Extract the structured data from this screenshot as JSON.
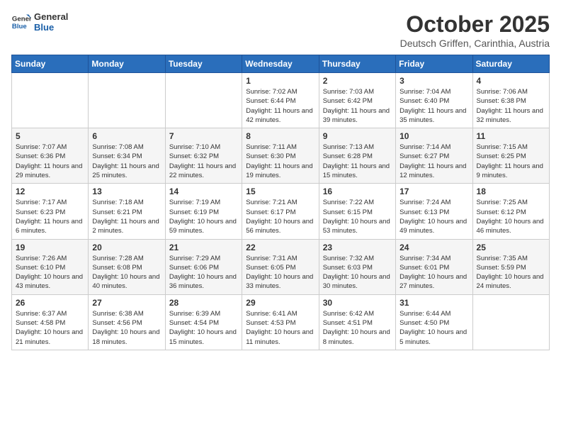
{
  "header": {
    "logo_line1": "General",
    "logo_line2": "Blue",
    "month": "October 2025",
    "location": "Deutsch Griffen, Carinthia, Austria"
  },
  "weekdays": [
    "Sunday",
    "Monday",
    "Tuesday",
    "Wednesday",
    "Thursday",
    "Friday",
    "Saturday"
  ],
  "weeks": [
    [
      {
        "day": "",
        "info": ""
      },
      {
        "day": "",
        "info": ""
      },
      {
        "day": "",
        "info": ""
      },
      {
        "day": "1",
        "info": "Sunrise: 7:02 AM\nSunset: 6:44 PM\nDaylight: 11 hours and 42 minutes."
      },
      {
        "day": "2",
        "info": "Sunrise: 7:03 AM\nSunset: 6:42 PM\nDaylight: 11 hours and 39 minutes."
      },
      {
        "day": "3",
        "info": "Sunrise: 7:04 AM\nSunset: 6:40 PM\nDaylight: 11 hours and 35 minutes."
      },
      {
        "day": "4",
        "info": "Sunrise: 7:06 AM\nSunset: 6:38 PM\nDaylight: 11 hours and 32 minutes."
      }
    ],
    [
      {
        "day": "5",
        "info": "Sunrise: 7:07 AM\nSunset: 6:36 PM\nDaylight: 11 hours and 29 minutes."
      },
      {
        "day": "6",
        "info": "Sunrise: 7:08 AM\nSunset: 6:34 PM\nDaylight: 11 hours and 25 minutes."
      },
      {
        "day": "7",
        "info": "Sunrise: 7:10 AM\nSunset: 6:32 PM\nDaylight: 11 hours and 22 minutes."
      },
      {
        "day": "8",
        "info": "Sunrise: 7:11 AM\nSunset: 6:30 PM\nDaylight: 11 hours and 19 minutes."
      },
      {
        "day": "9",
        "info": "Sunrise: 7:13 AM\nSunset: 6:28 PM\nDaylight: 11 hours and 15 minutes."
      },
      {
        "day": "10",
        "info": "Sunrise: 7:14 AM\nSunset: 6:27 PM\nDaylight: 11 hours and 12 minutes."
      },
      {
        "day": "11",
        "info": "Sunrise: 7:15 AM\nSunset: 6:25 PM\nDaylight: 11 hours and 9 minutes."
      }
    ],
    [
      {
        "day": "12",
        "info": "Sunrise: 7:17 AM\nSunset: 6:23 PM\nDaylight: 11 hours and 6 minutes."
      },
      {
        "day": "13",
        "info": "Sunrise: 7:18 AM\nSunset: 6:21 PM\nDaylight: 11 hours and 2 minutes."
      },
      {
        "day": "14",
        "info": "Sunrise: 7:19 AM\nSunset: 6:19 PM\nDaylight: 10 hours and 59 minutes."
      },
      {
        "day": "15",
        "info": "Sunrise: 7:21 AM\nSunset: 6:17 PM\nDaylight: 10 hours and 56 minutes."
      },
      {
        "day": "16",
        "info": "Sunrise: 7:22 AM\nSunset: 6:15 PM\nDaylight: 10 hours and 53 minutes."
      },
      {
        "day": "17",
        "info": "Sunrise: 7:24 AM\nSunset: 6:13 PM\nDaylight: 10 hours and 49 minutes."
      },
      {
        "day": "18",
        "info": "Sunrise: 7:25 AM\nSunset: 6:12 PM\nDaylight: 10 hours and 46 minutes."
      }
    ],
    [
      {
        "day": "19",
        "info": "Sunrise: 7:26 AM\nSunset: 6:10 PM\nDaylight: 10 hours and 43 minutes."
      },
      {
        "day": "20",
        "info": "Sunrise: 7:28 AM\nSunset: 6:08 PM\nDaylight: 10 hours and 40 minutes."
      },
      {
        "day": "21",
        "info": "Sunrise: 7:29 AM\nSunset: 6:06 PM\nDaylight: 10 hours and 36 minutes."
      },
      {
        "day": "22",
        "info": "Sunrise: 7:31 AM\nSunset: 6:05 PM\nDaylight: 10 hours and 33 minutes."
      },
      {
        "day": "23",
        "info": "Sunrise: 7:32 AM\nSunset: 6:03 PM\nDaylight: 10 hours and 30 minutes."
      },
      {
        "day": "24",
        "info": "Sunrise: 7:34 AM\nSunset: 6:01 PM\nDaylight: 10 hours and 27 minutes."
      },
      {
        "day": "25",
        "info": "Sunrise: 7:35 AM\nSunset: 5:59 PM\nDaylight: 10 hours and 24 minutes."
      }
    ],
    [
      {
        "day": "26",
        "info": "Sunrise: 6:37 AM\nSunset: 4:58 PM\nDaylight: 10 hours and 21 minutes."
      },
      {
        "day": "27",
        "info": "Sunrise: 6:38 AM\nSunset: 4:56 PM\nDaylight: 10 hours and 18 minutes."
      },
      {
        "day": "28",
        "info": "Sunrise: 6:39 AM\nSunset: 4:54 PM\nDaylight: 10 hours and 15 minutes."
      },
      {
        "day": "29",
        "info": "Sunrise: 6:41 AM\nSunset: 4:53 PM\nDaylight: 10 hours and 11 minutes."
      },
      {
        "day": "30",
        "info": "Sunrise: 6:42 AM\nSunset: 4:51 PM\nDaylight: 10 hours and 8 minutes."
      },
      {
        "day": "31",
        "info": "Sunrise: 6:44 AM\nSunset: 4:50 PM\nDaylight: 10 hours and 5 minutes."
      },
      {
        "day": "",
        "info": ""
      }
    ]
  ]
}
